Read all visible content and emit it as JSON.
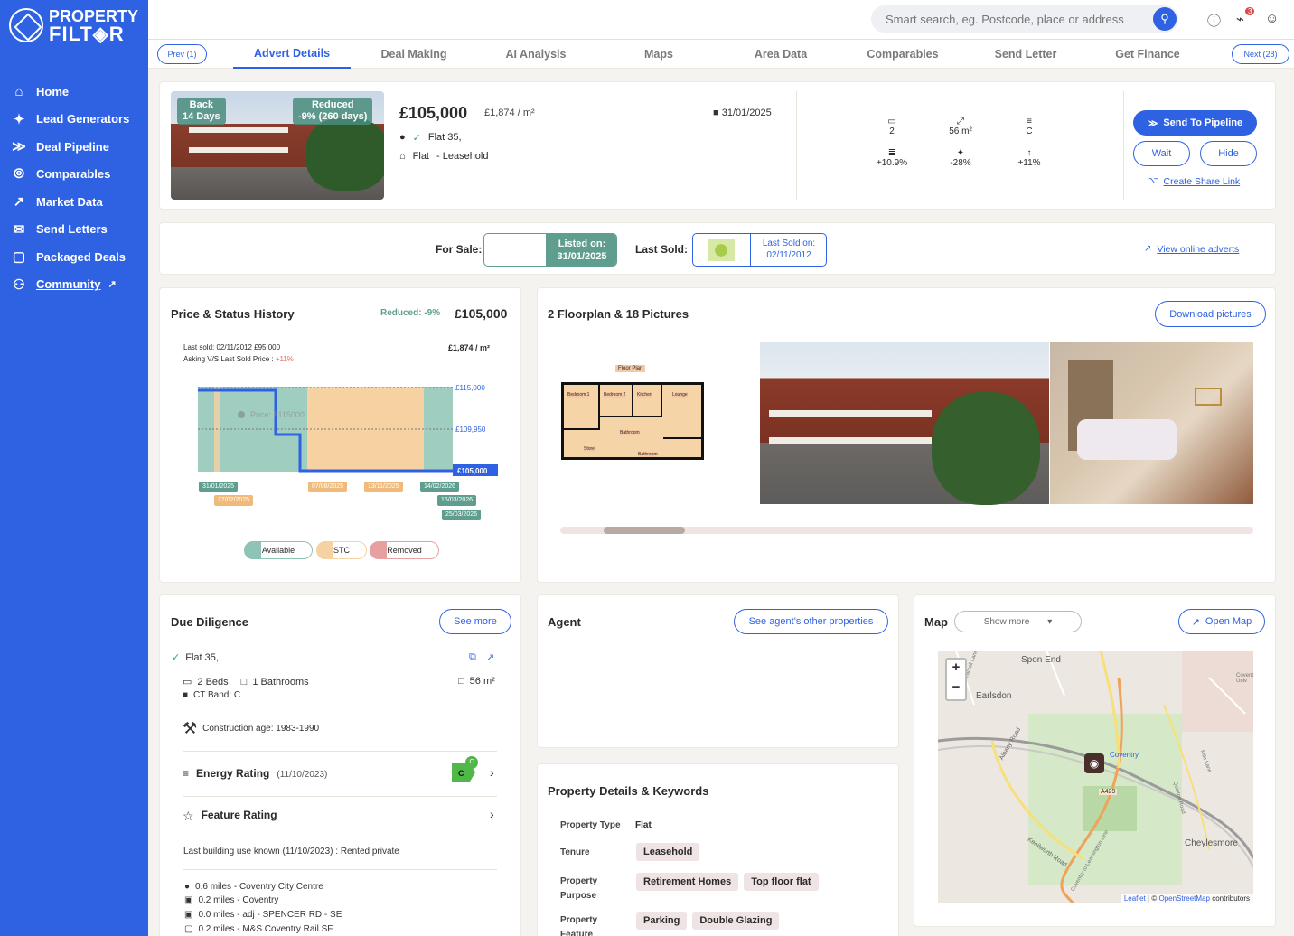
{
  "brand": {
    "line1": "PROPERTY",
    "line2": "FILT◈R"
  },
  "nav": [
    {
      "label": "Home",
      "icon": "home-icon",
      "glyph": "⌂"
    },
    {
      "label": "Lead Generators",
      "icon": "sparkle-icon",
      "glyph": "✦"
    },
    {
      "label": "Deal Pipeline",
      "icon": "pipeline-icon",
      "glyph": "≫"
    },
    {
      "label": "Comparables",
      "icon": "compare-icon",
      "glyph": "⦾"
    },
    {
      "label": "Market Data",
      "icon": "trend-icon",
      "glyph": "↗"
    },
    {
      "label": "Send Letters",
      "icon": "mail-icon",
      "glyph": "✉"
    },
    {
      "label": "Packaged Deals",
      "icon": "cart-icon",
      "glyph": "▢"
    },
    {
      "label": "Community",
      "icon": "people-icon",
      "glyph": "⚇"
    }
  ],
  "search": {
    "placeholder": "Smart search, eg. Postcode, place or address"
  },
  "notifications": {
    "count": "3"
  },
  "tabs": {
    "prev": "Prev (1)",
    "next": "Next (28)",
    "items": [
      "Advert Details",
      "Deal Making",
      "AI Analysis",
      "Maps",
      "Area Data",
      "Comparables",
      "Send Letter",
      "Get Finance"
    ]
  },
  "summary": {
    "back_line1": "Back",
    "back_line2": "14 Days",
    "reduced_line1": "Reduced",
    "reduced_line2": "-9% (260 days)",
    "price": "£105,000",
    "ppsqm": "£1,874 / m²",
    "date": "31/01/2025",
    "address": "Flat 35,",
    "type": "Flat",
    "tenure": "- Leasehold",
    "stats": [
      {
        "value": "2",
        "icon": "bed-icon",
        "glyph": "▭"
      },
      {
        "value": "56 m²",
        "icon": "area-icon",
        "glyph": "⤢"
      },
      {
        "value": "C",
        "icon": "epc-icon",
        "glyph": "≡"
      },
      {
        "value": "+10.9%",
        "icon": "coins-icon",
        "glyph": "≣"
      },
      {
        "value": "-28%",
        "icon": "size-compare-icon",
        "glyph": "✦"
      },
      {
        "value": "+11%",
        "icon": "growth-icon",
        "glyph": "↑"
      }
    ],
    "send_pipeline": "Send To Pipeline",
    "wait": "Wait",
    "hide": "Hide",
    "share": "Create Share Link"
  },
  "listing": {
    "for_sale": "For Sale:",
    "listed_on_label": "Listed on:",
    "listed_on": "31/01/2025",
    "last_sold": "Last Sold:",
    "last_sold_label": "Last Sold on:",
    "last_sold_date": "02/11/2012",
    "view_adverts": "View online adverts"
  },
  "history": {
    "title": "Price & Status History",
    "reduced": "Reduced: -9%",
    "price": "£105,000",
    "last_sold_note": "Last sold: 02/11/2012 £95,000",
    "asking_note": "Asking V/S Last Sold Price : ",
    "asking_pct": "+11%",
    "ppsqm": "£1,874 / m²",
    "y_labels": [
      "£115,000",
      "£109,950",
      "£105,000"
    ],
    "faded_label": "Price: £115000",
    "dates_green": [
      "31/01/2025",
      "14/02/2026",
      "16/03/2026",
      "25/03/2026"
    ],
    "dates_orange": [
      "27/02/2025",
      "07/08/2025",
      "13/11/2025"
    ],
    "legend": [
      "Available",
      "STC",
      "Removed"
    ]
  },
  "gallery": {
    "title": "2 Floorplan & 18 Pictures",
    "download": "Download pictures",
    "floor_plan": "Floor Plan",
    "rooms": [
      "Bedroom 1",
      "Bedroom 2",
      "Kitchen",
      "Lounge",
      "Store",
      "Bathroom",
      "Bathroom"
    ]
  },
  "due": {
    "title": "Due Diligence",
    "see_more": "See more",
    "address": "Flat 35,",
    "beds": "2 Beds",
    "baths": "1 Bathrooms",
    "area": "56 m²",
    "ct_band": "CT Band: C",
    "construction": "Construction age: 1983-1990",
    "energy": "Energy Rating",
    "energy_date": "(11/10/2023)",
    "energy_grade": "C",
    "energy_grade_small": "C",
    "feature": "Feature Rating",
    "last_use": "Last building use known (11/10/2023) : Rented private",
    "nearby": [
      "0.6 miles - Coventry City Centre",
      "0.2 miles - Coventry",
      "0.0 miles - adj - SPENCER RD - SE",
      "0.2 miles - M&S Coventry Rail SF"
    ]
  },
  "agent": {
    "title": "Agent",
    "other": "See agent's other properties"
  },
  "details": {
    "title": "Property Details & Keywords",
    "type_label": "Property Type",
    "type_value": "Flat",
    "tenure_label": "Tenure",
    "tenure_tags": [
      "Leasehold"
    ],
    "purpose_label1": "Property",
    "purpose_label2": "Purpose",
    "purpose_tags": [
      "Retirement Homes",
      "Top floor flat"
    ],
    "feature_label1": "Property",
    "feature_label2": "Feature",
    "feature_tags": [
      "Parking",
      "Double Glazing"
    ]
  },
  "map": {
    "title": "Map",
    "show_more": "Show more",
    "open": "Open Map",
    "zoom_in": "+",
    "zoom_out": "−",
    "places": [
      "Spon End",
      "Earlsdon",
      "Coventry",
      "Cheylesmore",
      "A429",
      "Albany Road",
      "Kenilworth Road",
      "Coventry to Leamington Line",
      "Mile Lane",
      "Quinton Road",
      "Hearsall Lane",
      "Coventry Univ"
    ],
    "attribution_leaflet": "Leaflet",
    "attribution_sep": " | © ",
    "attribution_osm": "OpenStreetMap",
    "attribution_tail": " contributors"
  },
  "colors": {
    "brand": "#2f62e3",
    "teal": "#5f9e8f",
    "orange": "#f3c892",
    "red": "#e7a0a0"
  }
}
